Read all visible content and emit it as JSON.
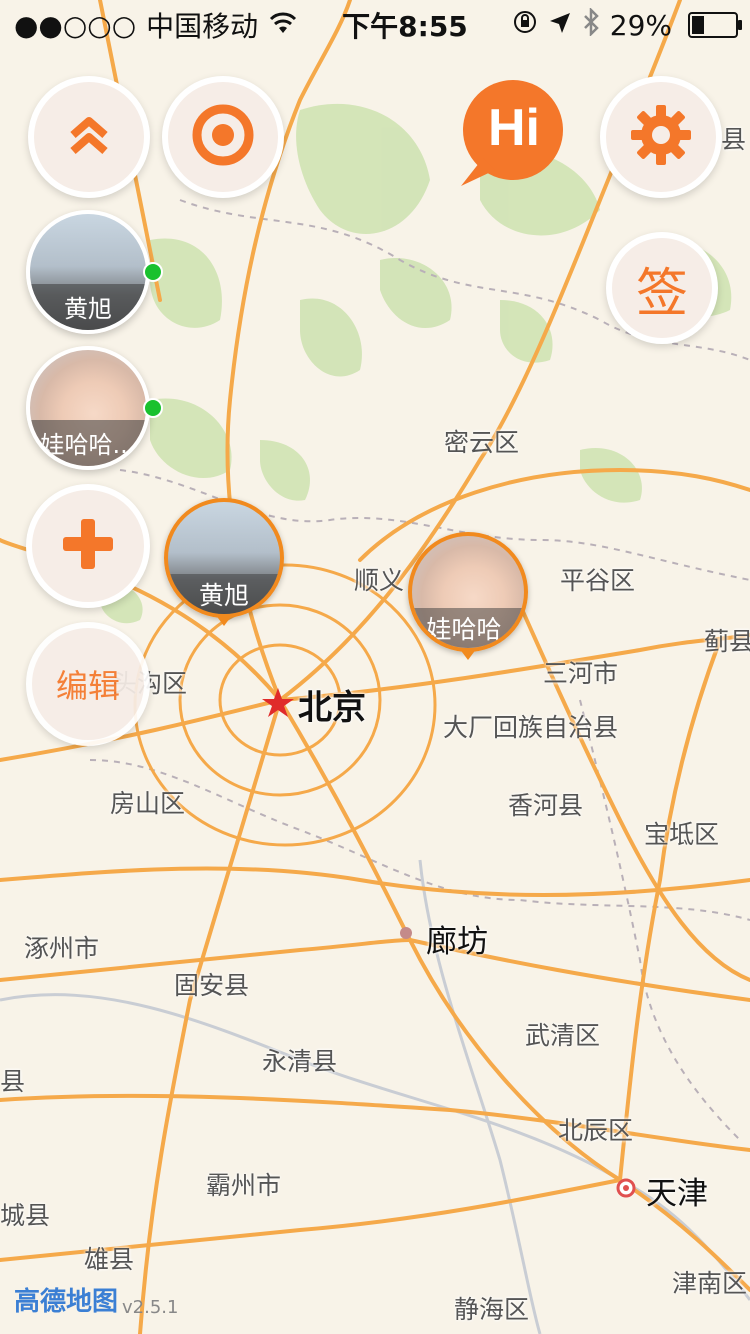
{
  "status_bar": {
    "signal_text": "●●○○○",
    "carrier": "中国移动",
    "time": "下午8:55",
    "battery_percent": "29%",
    "battery_level": 0.29
  },
  "buttons": {
    "collapse_icon": "chevrons-up-icon",
    "locate_icon": "target-icon",
    "hi_label": "Hi",
    "settings_icon": "gear-icon",
    "sign_label": "签",
    "add_icon": "plus-icon",
    "edit_label": "编辑"
  },
  "friends": [
    {
      "name": "黄旭",
      "online": true
    },
    {
      "name": "娃哈哈...",
      "online": true
    }
  ],
  "map_markers": [
    {
      "name": "黄旭"
    },
    {
      "name": "娃哈哈."
    }
  ],
  "places": {
    "miyun": "密云区",
    "shunyi": "顺义",
    "pinggu": "平谷区",
    "mentougou": "头沟区",
    "beijing": "北京",
    "sanhe": "三河市",
    "dachang": "大厂回族自治县",
    "fangshan": "房山区",
    "xianghe": "香河县",
    "baodi": "宝坻区",
    "ji": "蓟县",
    "zhuozhou": "涿州市",
    "langfang": "廊坊",
    "guan": "固安县",
    "wuqing": "武清区",
    "yongqing": "永清县",
    "beichen": "北辰区",
    "bazhou": "霸州市",
    "tianjin": "天津",
    "xiongxian": "雄县",
    "jinghai": "静海区",
    "jinnan": "津南区",
    "edge_cheng": "城县",
    "edge_xian": "县",
    "edge_ping": "平县"
  },
  "footer": {
    "logo": "高德地图",
    "version": "v2.5.1"
  },
  "colors": {
    "accent": "#f4772a",
    "road": "#f5a94a",
    "online": "#19c12e"
  }
}
